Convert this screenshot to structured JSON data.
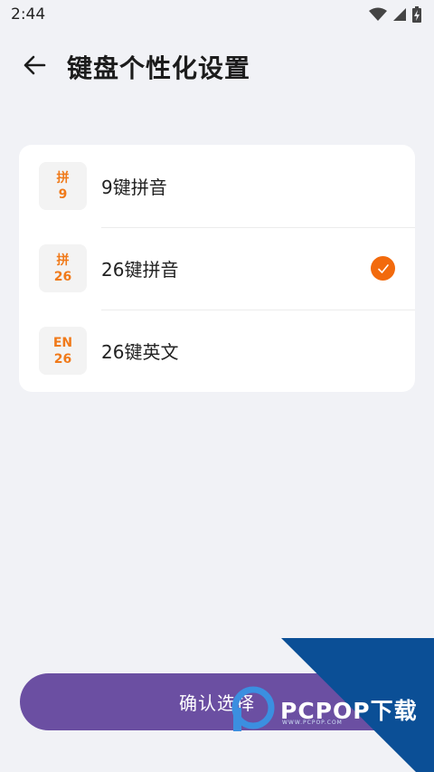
{
  "status_bar": {
    "time": "2:44"
  },
  "header": {
    "title": "键盘个性化设置"
  },
  "options": [
    {
      "icon_top": "拼",
      "icon_bottom": "9",
      "label": "9键拼音",
      "selected": false
    },
    {
      "icon_top": "拼",
      "icon_bottom": "26",
      "label": "26键拼音",
      "selected": true
    },
    {
      "icon_top": "EN",
      "icon_bottom": "26",
      "label": "26键英文",
      "selected": false
    }
  ],
  "confirm_button": {
    "label": "确认选择"
  },
  "watermark": {
    "brand": "PCPOP下载",
    "sub": "WWW.PCPOP.COM"
  },
  "colors": {
    "accent": "#f26a0d",
    "primary_button": "#6b4fa2",
    "background": "#f1f2f6",
    "watermark_blue": "#0b4f96"
  }
}
